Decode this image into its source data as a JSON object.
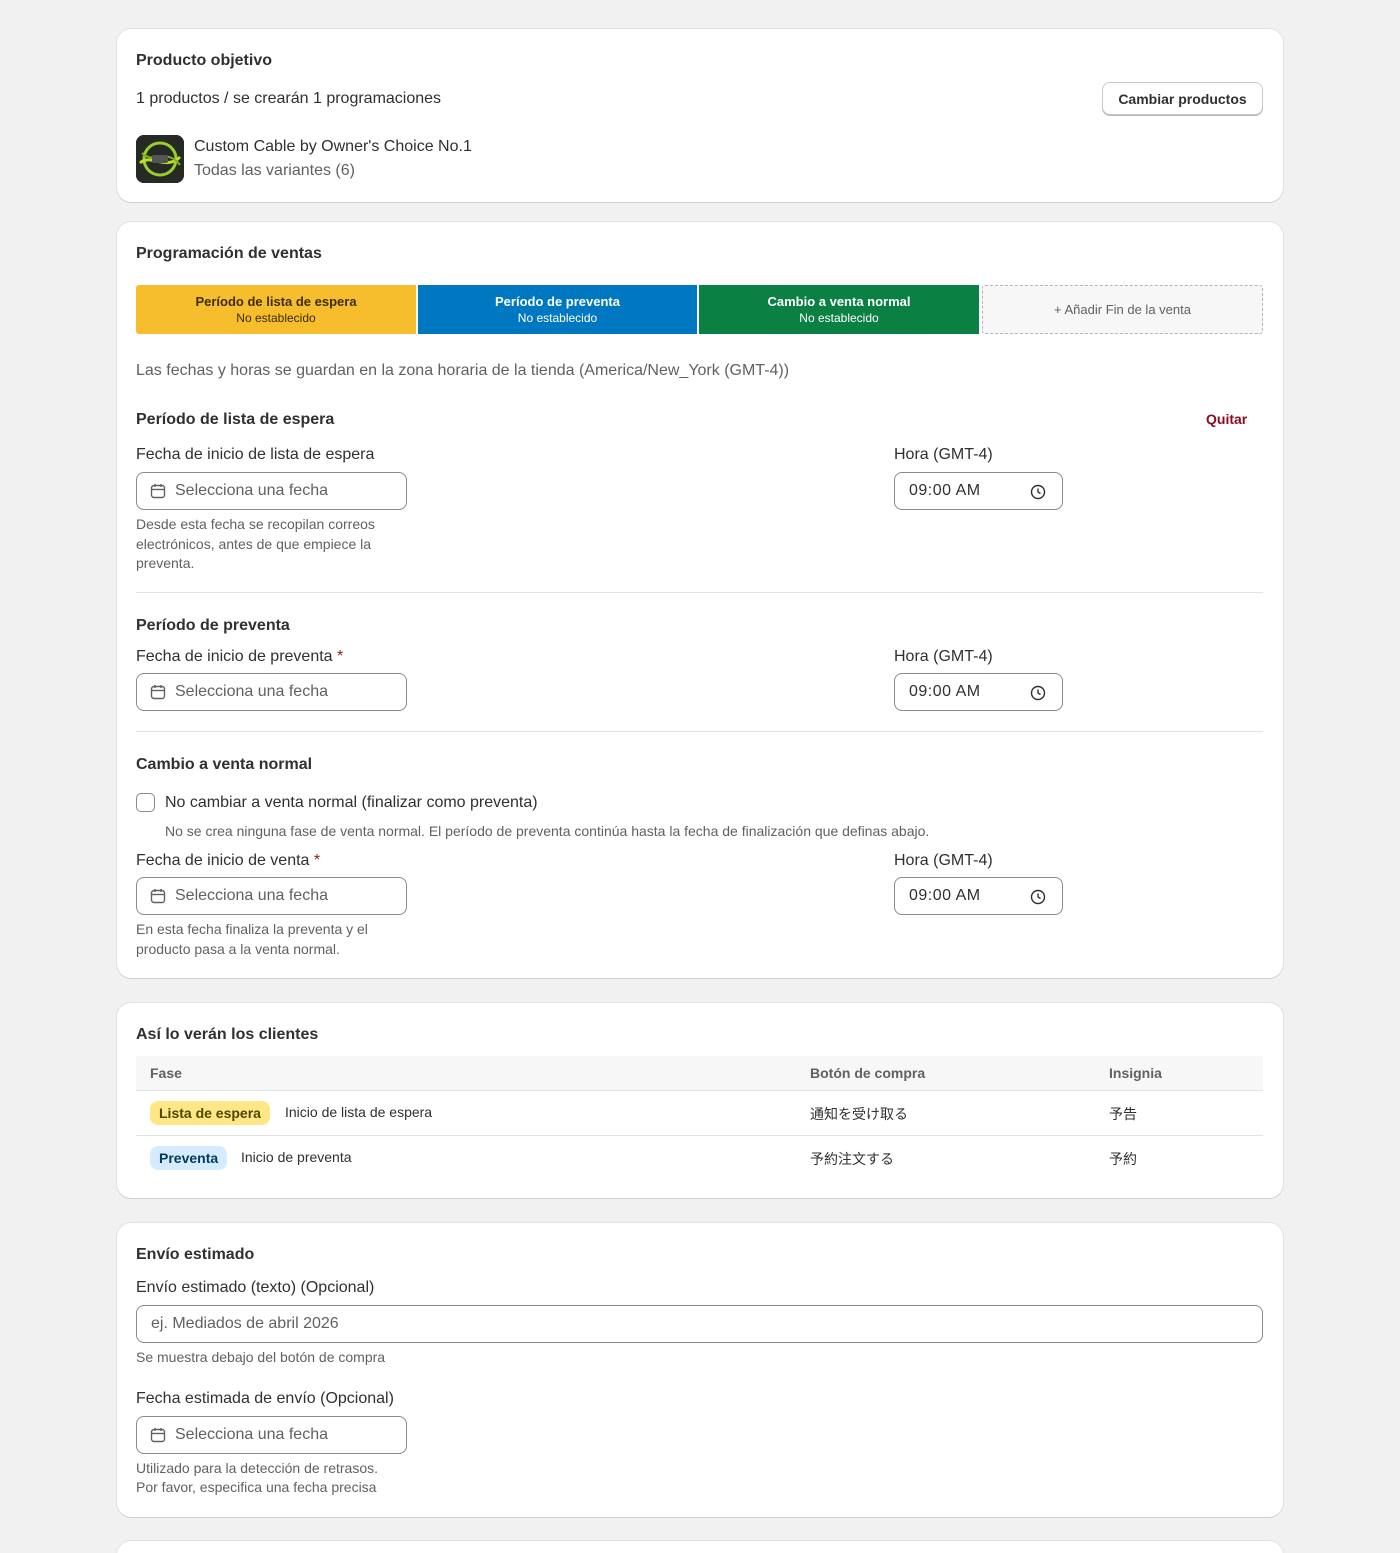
{
  "product_card": {
    "title": "Producto objetivo",
    "summary": "1 productos / se crearán 1 programaciones",
    "change_button": "Cambiar productos",
    "product_name": "Custom Cable by Owner's Choice No.1",
    "product_variants": "Todas las variantes (6)"
  },
  "schedule_card": {
    "title": "Programación de ventas",
    "timeline": [
      {
        "title": "Período de lista de espera",
        "status": "No establecido",
        "color": "#f6bd2d"
      },
      {
        "title": "Período de preventa",
        "status": "No establecido",
        "color": "#0078c1"
      },
      {
        "title": "Cambio a venta normal",
        "status": "No establecido",
        "color": "#0a8043"
      }
    ],
    "add_end_label": "+ Añadir Fin de la venta",
    "timezone_note": "Las fechas y horas se guardan en la zona horaria de la tienda (America/New_York (GMT-4))",
    "waitlist": {
      "heading": "Período de lista de espera",
      "remove_label": "Quitar",
      "date_label": "Fecha de inicio de lista de espera",
      "date_placeholder": "Selecciona una fecha",
      "date_help": "Desde esta fecha se recopilan correos electrónicos, antes de que empiece la preventa.",
      "time_label": "Hora (GMT-4)",
      "time_value": "09:00 AM"
    },
    "preorder": {
      "heading": "Período de preventa",
      "date_label": "Fecha de inicio de preventa",
      "required_mark": "*",
      "date_placeholder": "Selecciona una fecha",
      "time_label": "Hora (GMT-4)",
      "time_value": "09:00 AM"
    },
    "normal_sale": {
      "heading": "Cambio a venta normal",
      "checkbox_label": "No cambiar a venta normal (finalizar como preventa)",
      "checkbox_help": "No se crea ninguna fase de venta normal. El período de preventa continúa hasta la fecha de finalización que definas abajo.",
      "date_label": "Fecha de inicio de venta",
      "required_mark": "*",
      "date_placeholder": "Selecciona una fecha",
      "date_help": "En esta fecha finaliza la preventa y el producto pasa a la venta normal.",
      "time_label": "Hora (GMT-4)",
      "time_value": "09:00 AM"
    }
  },
  "preview_card": {
    "title": "Así lo verán los clientes",
    "columns": [
      "Fase",
      "Botón de compra",
      "Insignia"
    ],
    "rows": [
      {
        "badge": "Lista de espera",
        "phase": "Inicio de lista de espera",
        "button": "通知を受け取る",
        "insignia": "予告"
      },
      {
        "badge": "Preventa",
        "phase": "Inicio de preventa",
        "button": "予約注文する",
        "insignia": "予約"
      }
    ]
  },
  "shipping_card": {
    "title": "Envío estimado",
    "text_label": "Envío estimado (texto) (Opcional)",
    "text_placeholder": "ej. Mediados de abril 2026",
    "text_help": "Se muestra debajo del botón de compra",
    "date_label": "Fecha estimada de envío (Opcional)",
    "date_placeholder": "Selecciona una fecha",
    "date_help_1": "Utilizado para la detección de retrasos.",
    "date_help_2": "Por favor, especifica una fecha precisa"
  }
}
